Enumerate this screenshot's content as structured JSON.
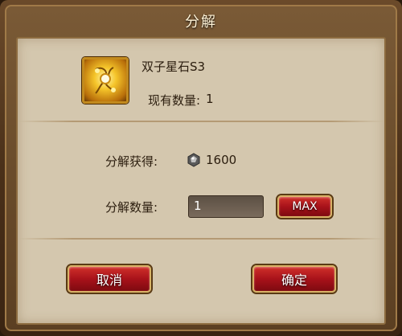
{
  "dialog": {
    "title": "分解"
  },
  "item": {
    "icon": "golden-gem-icon",
    "name": "双子星石S3",
    "owned_label": "现有数量:",
    "owned_value": "1"
  },
  "decompose": {
    "gain_label": "分解获得:",
    "gain_icon": "ore-icon",
    "gain_value": "1600",
    "quantity_label": "分解数量:",
    "quantity_value": "1",
    "max_label": "MAX"
  },
  "buttons": {
    "cancel": "取消",
    "confirm": "确定"
  },
  "colors": {
    "button_red": "#a8121a",
    "panel": "#d4c7ae",
    "frame": "#5b3f22",
    "button_border": "#d9b266"
  }
}
